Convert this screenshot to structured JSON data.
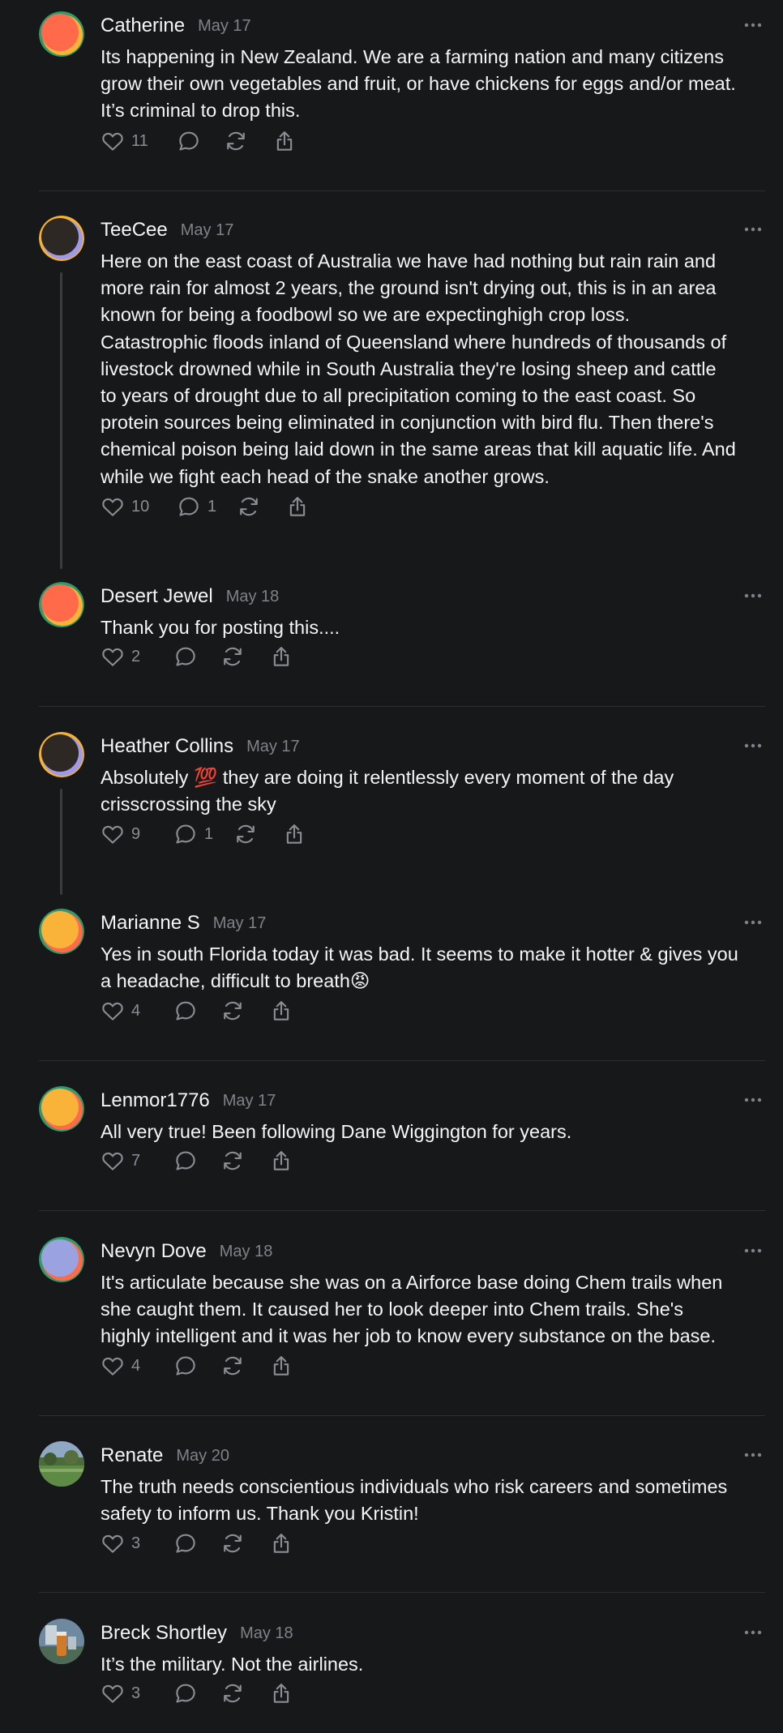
{
  "theme": {
    "background": "#17181a",
    "text": "#f3f5f7",
    "muted": "#7f8288",
    "divider": "#2c2e31"
  },
  "icons": {
    "like": "heart-icon",
    "reply": "comment-icon",
    "repost": "repost-icon",
    "share": "share-icon",
    "more": "more-icon"
  },
  "posts": [
    {
      "name": "Catherine",
      "date": "May 17",
      "avatar": {
        "kind": "blob",
        "colors": [
          "#ff6b4a",
          "#f9b339",
          "#2f9a6a"
        ]
      },
      "lines": [
        "Its happening in New Zealand. We are a farming nation and many citizens",
        "grow their own vegetables and fruit, or have chickens for eggs and/or meat.",
        "It’s criminal to drop this."
      ],
      "likes": "11",
      "replies": ""
    },
    {
      "name": "TeeCee",
      "date": "May 17",
      "avatar": {
        "kind": "blob",
        "colors": [
          "#2d2824",
          "#9e9ae6",
          "#f5b12f"
        ]
      },
      "lines": [
        "Here on the east coast of Australia we have had nothing but rain rain and",
        "more rain for almost 2 years, the ground isn't drying out, this is in an area",
        "known for being a foodbowl so we are expectinghigh crop loss.",
        "Catastrophic floods inland of Queensland where hundreds of thousands of",
        "livestock drowned while in South Australia they're losing sheep and cattle",
        "to years of drought due to all precipitation coming to the east coast. So",
        "protein sources being eliminated in conjunction with bird flu. Then there's",
        "chemical poison being laid down in the same areas that kill aquatic life. And",
        "while we fight each head of the snake another grows."
      ],
      "likes": "10",
      "replies": "1"
    },
    {
      "name": "Desert Jewel",
      "date": "May 18",
      "avatar": {
        "kind": "blob",
        "colors": [
          "#ff6b4a",
          "#f9b339",
          "#2f9a6a"
        ]
      },
      "lines": [
        "Thank you for posting this...."
      ],
      "likes": "2",
      "replies": ""
    },
    {
      "name": "Heather Collins",
      "date": "May 17",
      "avatar": {
        "kind": "blob",
        "colors": [
          "#2d2824",
          "#9e9ae6",
          "#f5b12f"
        ]
      },
      "lines": [
        "Absolutely 💯 they are doing it relentlessly every moment of the day",
        "crisscrossing the sky"
      ],
      "likes": "9",
      "replies": "1"
    },
    {
      "name": "Marianne S",
      "date": "May 17",
      "avatar": {
        "kind": "blob",
        "colors": [
          "#f9b339",
          "#ff6b4a",
          "#2f9a6a"
        ]
      },
      "lines": [
        "Yes in south Florida today it was bad. It seems to make it hotter & gives you",
        "a headache, difficult to breath😡"
      ],
      "likes": "4",
      "replies": ""
    },
    {
      "name": "Lenmor1776",
      "date": "May 17",
      "avatar": {
        "kind": "blob",
        "colors": [
          "#f9b339",
          "#ff6b4a",
          "#2f9a6a"
        ]
      },
      "lines": [
        "All very true! Been following Dane Wiggington for years."
      ],
      "likes": "7",
      "replies": ""
    },
    {
      "name": "Nevyn Dove",
      "date": "May 18",
      "avatar": {
        "kind": "blob",
        "colors": [
          "#9aa3e0",
          "#ff6b4a",
          "#2f9a6a"
        ]
      },
      "lines": [
        "It's articulate because she was on a Airforce base doing Chem trails when",
        "she caught them. It caused her to look deeper into Chem trails. She's",
        "highly intelligent and it was her job to know every substance on the base."
      ],
      "likes": "4",
      "replies": ""
    },
    {
      "name": "Renate",
      "date": "May 20",
      "avatar": {
        "kind": "photo-landscape"
      },
      "lines": [
        "The truth needs conscientious individuals who risk careers and sometimes",
        "safety to inform us. Thank you Kristin!"
      ],
      "likes": "3",
      "replies": ""
    },
    {
      "name": "Breck Shortley",
      "date": "May 18",
      "avatar": {
        "kind": "photo-drink"
      },
      "lines": [
        "It’s the military. Not the airlines."
      ],
      "likes": "3",
      "replies": ""
    }
  ]
}
